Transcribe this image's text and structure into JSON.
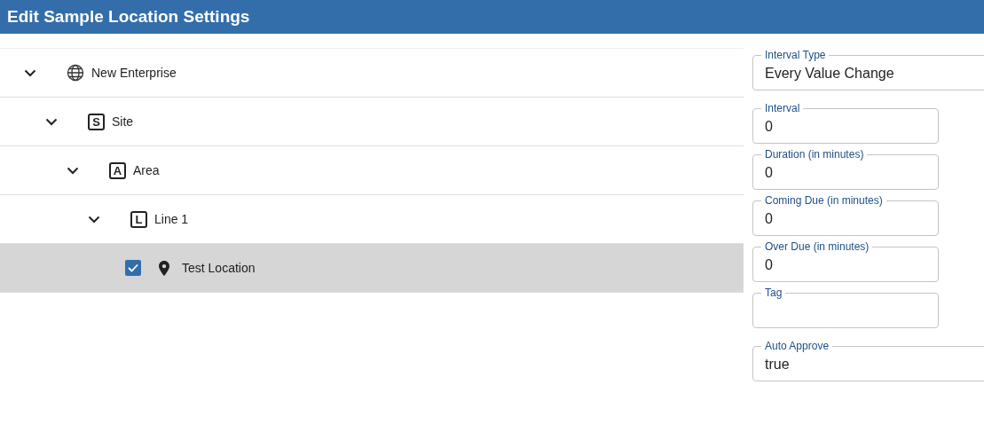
{
  "window": {
    "title": "Edit Sample Location Settings"
  },
  "tree": [
    {
      "label": "New Enterprise",
      "kind": "globe",
      "expanded": true,
      "selected": false,
      "children": [
        {
          "label": "Site",
          "kind": "letter",
          "badge": "S",
          "expanded": true,
          "selected": false,
          "children": [
            {
              "label": "Area",
              "kind": "letter",
              "badge": "A",
              "expanded": true,
              "selected": false,
              "children": [
                {
                  "label": "Line 1",
                  "kind": "letter",
                  "badge": "L",
                  "expanded": true,
                  "selected": false,
                  "children": [
                    {
                      "label": "Test Location",
                      "kind": "location",
                      "checked": true,
                      "selected": true
                    }
                  ]
                }
              ]
            }
          ]
        }
      ]
    }
  ],
  "fields": [
    {
      "label": "Interval Type",
      "kind": "select",
      "value": "Every Value Change"
    },
    {
      "label": "Interval",
      "kind": "text",
      "value": "0"
    },
    {
      "label": "Duration (in minutes)",
      "kind": "text",
      "value": "0"
    },
    {
      "label": "Coming Due (in minutes)",
      "kind": "text",
      "value": "0"
    },
    {
      "label": "Over Due (in minutes)",
      "kind": "text",
      "value": "0"
    },
    {
      "label": "Tag",
      "kind": "text"
    },
    {
      "label": "Auto Approve",
      "kind": "select",
      "value": "true"
    }
  ]
}
